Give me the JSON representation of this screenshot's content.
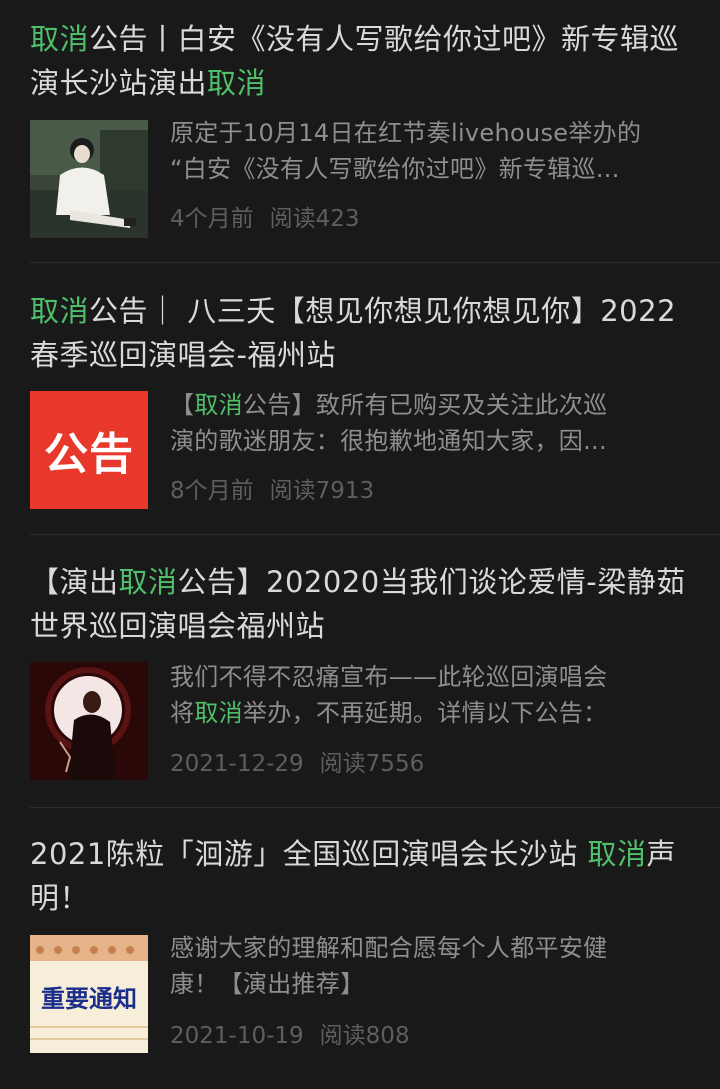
{
  "articles": [
    {
      "title_parts": [
        {
          "text": "取消",
          "hl": true
        },
        {
          "text": "公告丨白安《没有人写歌给你过吧》新专辑巡演长沙站演出",
          "hl": false
        },
        {
          "text": "取消",
          "hl": true
        }
      ],
      "summary_lines": [
        [
          {
            "text": "原定于10月14日在红节奏livehouse举办的",
            "hl": false
          }
        ],
        [
          {
            "text": "“白安《没有人写歌给你过吧》新专辑巡...",
            "hl": false
          }
        ]
      ],
      "time": "4个月前",
      "reads": "阅读423",
      "thumb": "photo-woman-sweater"
    },
    {
      "title_parts": [
        {
          "text": "取消",
          "hl": true
        },
        {
          "text": "公告｜ 八三夭【想见你想见你想见你】2022春季巡回演唱会-福州站",
          "hl": false
        }
      ],
      "summary_lines": [
        [
          {
            "text": "【",
            "hl": false
          },
          {
            "text": "取消",
            "hl": true
          },
          {
            "text": "公告】致所有已购买及关注此次巡",
            "hl": false
          }
        ],
        [
          {
            "text": "演的歌迷朋友：很抱歉地通知大家，因...",
            "hl": false
          }
        ]
      ],
      "time": "8个月前",
      "reads": "阅读7913",
      "thumb": "notice-red",
      "thumb_text": "公告"
    },
    {
      "title_parts": [
        {
          "text": "【演出",
          "hl": false
        },
        {
          "text": "取消",
          "hl": true
        },
        {
          "text": "公告】202020当我们谈论爱情-梁静茹世界巡回演唱会福州站",
          "hl": false
        }
      ],
      "summary_lines": [
        [
          {
            "text": "我们不得不忍痛宣布——此轮巡回演唱会",
            "hl": false
          }
        ],
        [
          {
            "text": "将",
            "hl": false
          },
          {
            "text": "取消",
            "hl": true
          },
          {
            "text": "举办，不再延期。详情以下公告：",
            "hl": false
          }
        ]
      ],
      "time": "2021-12-29",
      "reads": "阅读7556",
      "thumb": "photo-moon-singer"
    },
    {
      "title_parts": [
        {
          "text": "2021陈粒「洄游」全国巡回演唱会长沙站 ",
          "hl": false
        },
        {
          "text": "取消",
          "hl": true
        },
        {
          "text": "声明！",
          "hl": false
        }
      ],
      "summary_lines": [
        [
          {
            "text": "感谢大家的理解和配合愿每个人都平安健",
            "hl": false
          }
        ],
        [
          {
            "text": "康！【演出推荐】",
            "hl": false
          }
        ]
      ],
      "time": "2021-10-19",
      "reads": "阅读808",
      "thumb": "notice-notebook",
      "thumb_text": "重要通知"
    }
  ],
  "colors": {
    "background": "#191919",
    "highlight": "#4fbf6b",
    "title": "#d9d9d9",
    "summary": "#8e8e8e",
    "meta": "#5e5e5e"
  }
}
